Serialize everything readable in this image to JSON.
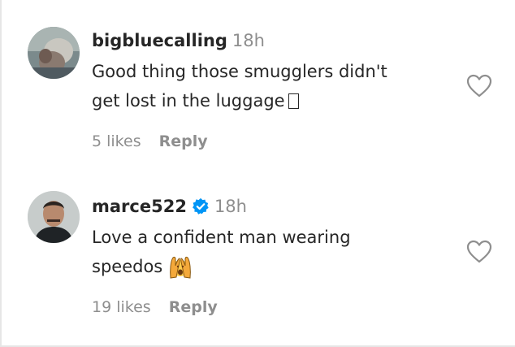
{
  "comments": [
    {
      "username": "bigbluecalling",
      "time": "18h",
      "verified": false,
      "text_line1": "Good thing those smugglers didn't",
      "text_line2": "get lost in the luggage",
      "trailing_glyph": "missing-glyph-box",
      "likes": "5 likes",
      "reply": "Reply"
    },
    {
      "username": "marce522",
      "time": "18h",
      "verified": true,
      "text_line1": "Love a confident man wearing",
      "text_line2": "speedos",
      "trailing_emoji": "person-raising-hands-emoji",
      "likes": "19 likes",
      "reply": "Reply"
    }
  ],
  "colors": {
    "text": "#262626",
    "secondary": "#8e8e8e",
    "verified_badge": "#0095f6"
  }
}
